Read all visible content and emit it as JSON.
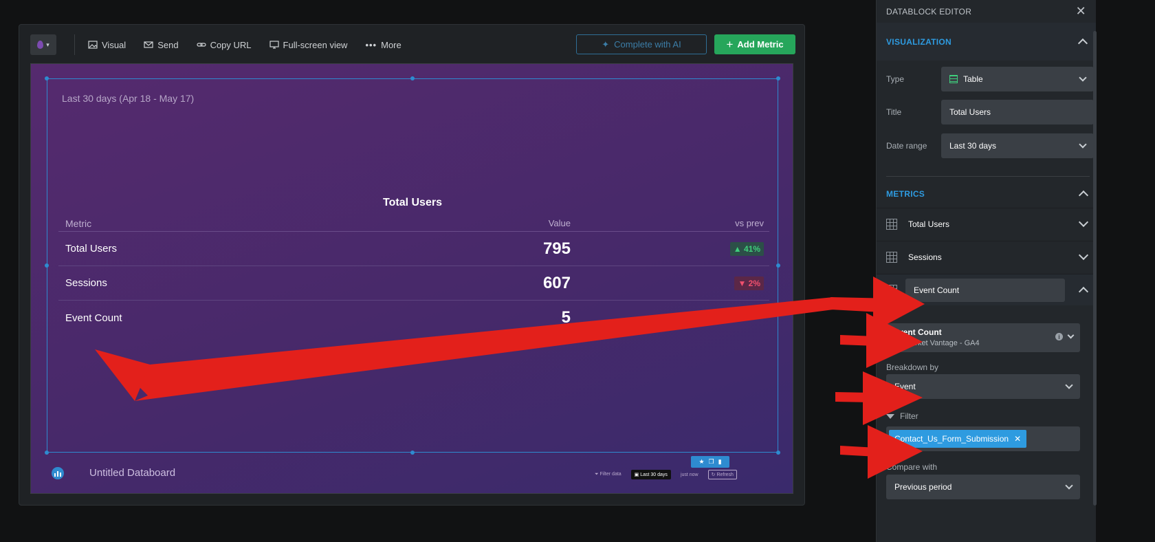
{
  "toolbar": {
    "visual": "Visual",
    "send": "Send",
    "copy_url": "Copy URL",
    "fullscreen": "Full-screen view",
    "more": "More",
    "complete_ai": "Complete with AI",
    "add_metric": "Add Metric"
  },
  "widget": {
    "date_caption": "Last 30 days (Apr 18 - May 17)",
    "title": "Total Users",
    "columns": [
      "Metric",
      "Value",
      "vs prev"
    ],
    "rows": [
      {
        "metric": "Total Users",
        "value": "795",
        "change": "▲ 41%",
        "direction": "up"
      },
      {
        "metric": "Sessions",
        "value": "607",
        "change": "▼ 2%",
        "direction": "down"
      },
      {
        "metric": "Event Count",
        "value": "5",
        "change": "",
        "direction": ""
      }
    ]
  },
  "footer": {
    "board_name": "Untitled Databoard",
    "filter_data": "Filter data",
    "date": "Last 30 days",
    "updated": "just now",
    "refresh": "Refresh"
  },
  "panel": {
    "header": "DATABLOCK EDITOR",
    "visualization": {
      "heading": "VISUALIZATION",
      "type_label": "Type",
      "type_value": "Table",
      "title_label": "Title",
      "title_value": "Total Users",
      "range_label": "Date range",
      "range_value": "Last 30 days"
    },
    "metrics": {
      "heading": "METRICS",
      "items": [
        "Total Users",
        "Sessions",
        "Event Count"
      ],
      "expanded": {
        "name": "Event Count",
        "source_title": "Event Count",
        "source_sub": "Market Vantage - GA4",
        "breakdown_label": "Breakdown by",
        "breakdown_value": "Event",
        "filter_label": "Filter",
        "filter_chip": "Contact_Us_Form_Submission",
        "compare_label": "Compare with",
        "compare_value": "Previous period"
      }
    }
  },
  "colors": {
    "accent": "#2e9be0",
    "add_button": "#26a65b",
    "arrow": "#e3201b",
    "canvas": "#4a2a6c"
  }
}
